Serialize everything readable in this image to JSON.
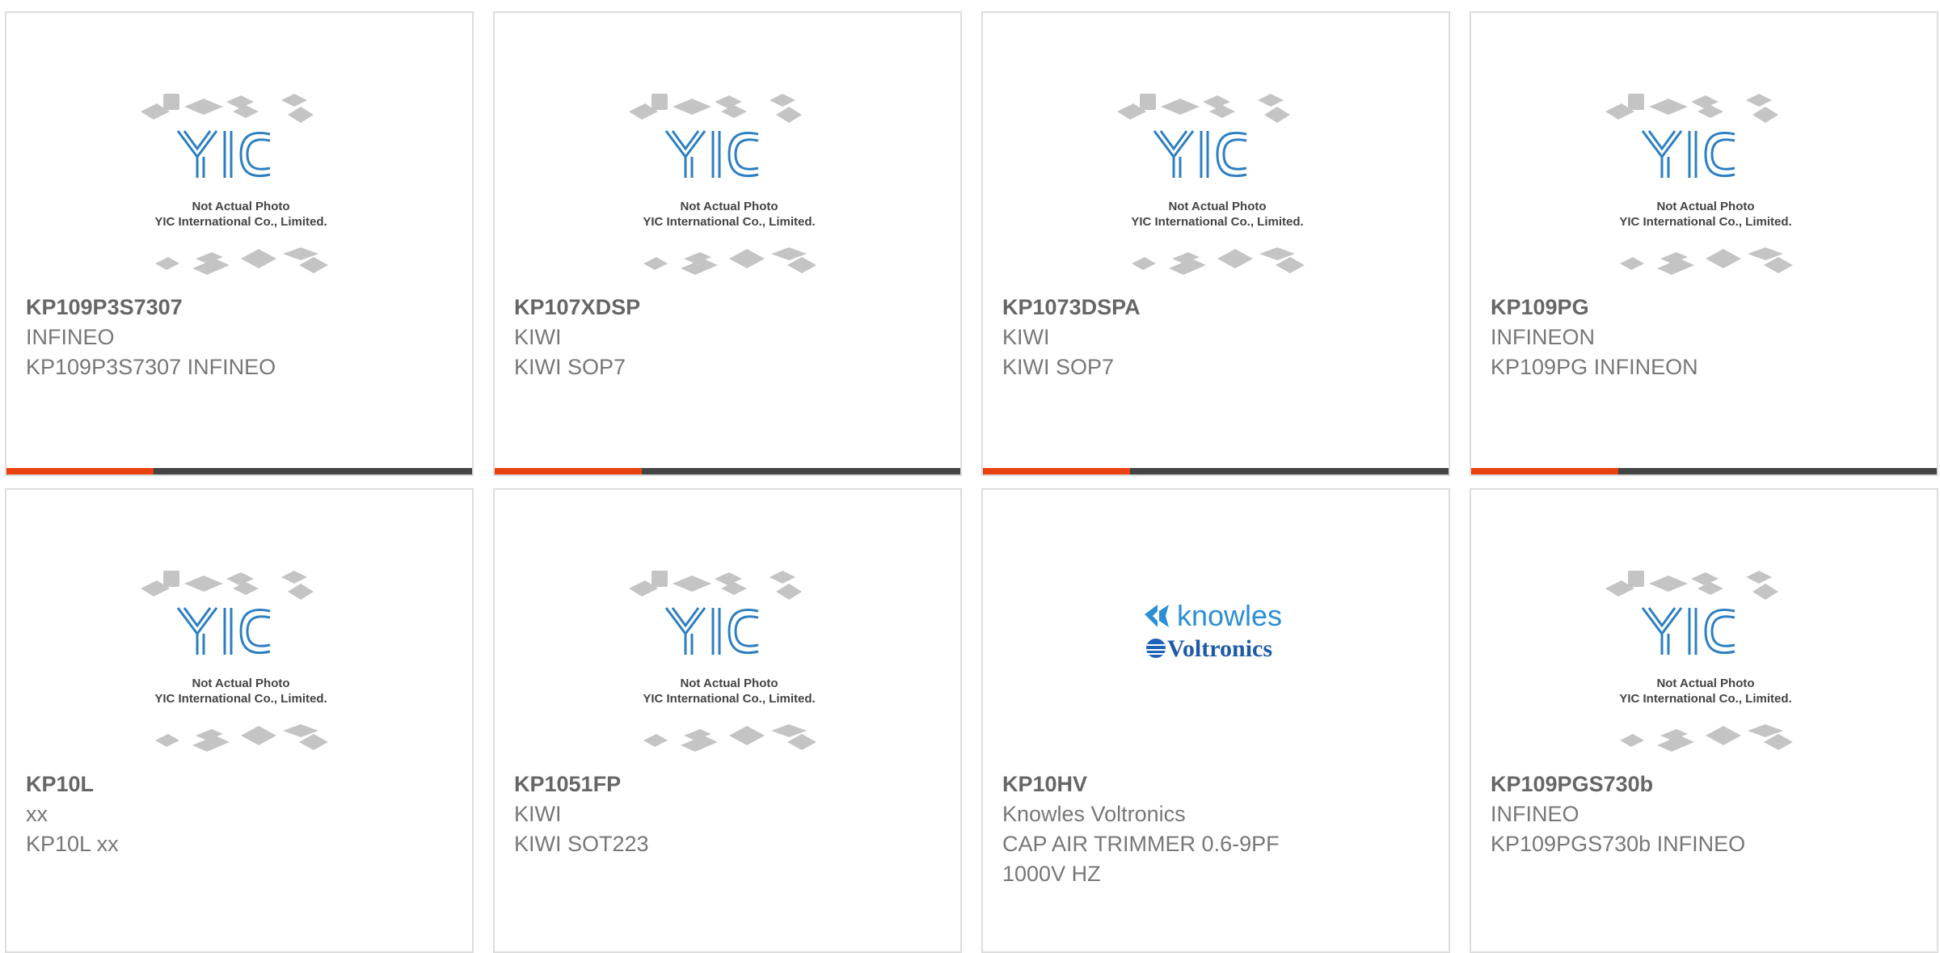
{
  "colors": {
    "accent": "#e8410f",
    "bar": "#444444",
    "yic_blue": "#2c7fc2",
    "chip_gray": "#bcbcbc"
  },
  "placeholder": {
    "caption_line1": "Not Actual Photo",
    "caption_line2": "YIC International Co., Limited."
  },
  "products": [
    {
      "part": "KP109P3S7307",
      "maker": "INFINEO",
      "desc": "KP109P3S7307 INFINEO"
    },
    {
      "part": "KP107XDSP",
      "maker": "KIWI",
      "desc": "KIWI SOP7"
    },
    {
      "part": "KP1073DSPA",
      "maker": "KIWI",
      "desc": "KIWI SOP7"
    },
    {
      "part": "KP109PG",
      "maker": "INFINEON",
      "desc": "KP109PG INFINEON"
    },
    {
      "part": "KP10L",
      "maker": "xx",
      "desc": "KP10L xx"
    },
    {
      "part": "KP1051FP",
      "maker": "KIWI",
      "desc": "KIWI SOT223"
    },
    {
      "part": "KP10HV",
      "maker": "Knowles Voltronics",
      "desc": "CAP AIR TRIMMER 0.6-9PF 1000V HZ",
      "logo": {
        "line1": "knowles",
        "line2": "Voltronics"
      }
    },
    {
      "part": "KP109PGS730b",
      "maker": "INFINEO",
      "desc": "KP109PGS730b INFINEO"
    }
  ]
}
